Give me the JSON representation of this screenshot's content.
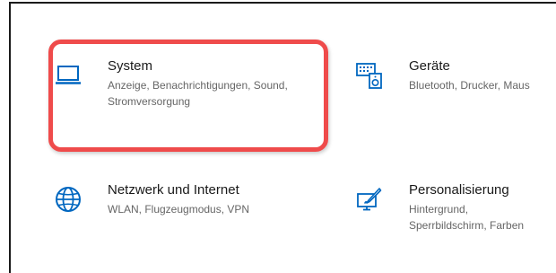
{
  "settings": {
    "tiles": [
      {
        "title": "System",
        "description": "Anzeige, Benachrichtigungen, Sound, Stromversorgung",
        "icon": "laptop-icon"
      },
      {
        "title": "Geräte",
        "description": "Bluetooth, Drucker, Maus",
        "icon": "devices-icon"
      },
      {
        "title": "Netzwerk und Internet",
        "description": "WLAN, Flugzeugmodus, VPN",
        "icon": "globe-icon"
      },
      {
        "title": "Personalisierung",
        "description": "Hintergrund, Sperrbildschirm, Farben",
        "icon": "personalization-icon"
      }
    ]
  },
  "colors": {
    "accent": "#0067c0",
    "highlight": "#ef4b4b",
    "title_text": "#1a1a1a",
    "description_text": "#666666"
  }
}
